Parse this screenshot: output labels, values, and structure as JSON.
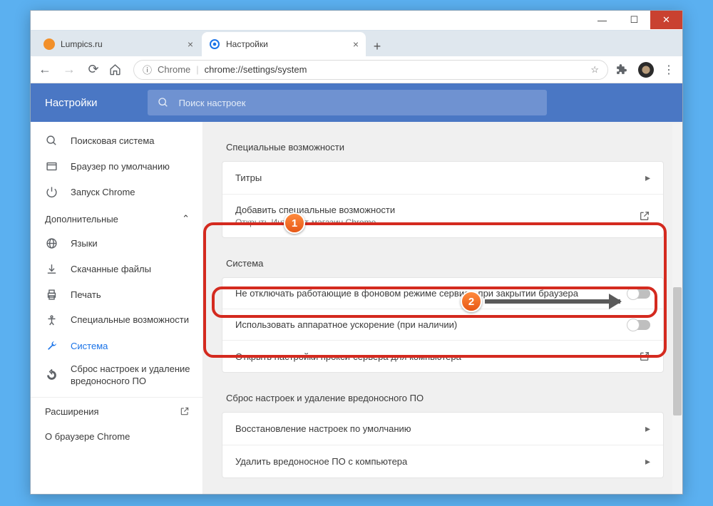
{
  "window": {
    "minimize": "—",
    "maximize": "☐",
    "close": "✕"
  },
  "tabs": {
    "items": [
      {
        "title": "Lumpics.ru",
        "favicon": "#f2902a",
        "active": false
      },
      {
        "title": "Настройки",
        "favicon": "#1a73e8",
        "active": true
      }
    ],
    "newtab": "+"
  },
  "toolbar": {
    "back": "←",
    "forward": "→",
    "reload": "⟳",
    "home": "⌂",
    "secure_icon": "ⓘ",
    "chrome_label": "Chrome",
    "url_path": "chrome://settings/system",
    "star": "☆",
    "ext": "✦",
    "menu": "⋮"
  },
  "header": {
    "title": "Настройки",
    "search_placeholder": "Поиск настроек"
  },
  "sidebar": {
    "items": [
      {
        "icon": "search",
        "label": "Поисковая система"
      },
      {
        "icon": "browser",
        "label": "Браузер по умолчанию"
      },
      {
        "icon": "power",
        "label": "Запуск Chrome"
      }
    ],
    "advanced_label": "Дополнительные",
    "advanced_items": [
      {
        "icon": "globe",
        "label": "Языки"
      },
      {
        "icon": "download",
        "label": "Скачанные файлы"
      },
      {
        "icon": "print",
        "label": "Печать"
      },
      {
        "icon": "accessibility",
        "label": "Специальные возможности"
      },
      {
        "icon": "wrench",
        "label": "Система",
        "active": true
      },
      {
        "icon": "reset",
        "label": "Сброс настроек и удаление вредоносного ПО"
      }
    ],
    "extensions": "Расширения",
    "about": "О браузере Chrome"
  },
  "main": {
    "accessibility": {
      "title": "Специальные возможности",
      "rows": [
        {
          "label": "Титры",
          "type": "chevron"
        },
        {
          "label": "Добавить специальные возможности",
          "sub": "Открыть Интернет-магазин Chrome",
          "type": "external"
        }
      ]
    },
    "system": {
      "title": "Система",
      "rows": [
        {
          "label": "Не отключать работающие в фоновом режиме сервисы при закрытии браузера",
          "type": "toggle"
        },
        {
          "label": "Использовать аппаратное ускорение (при наличии)",
          "type": "toggle"
        },
        {
          "label": "Открыть настройки прокси-сервера для компьютера",
          "type": "external"
        }
      ]
    },
    "reset": {
      "title": "Сброс настроек и удаление вредоносного ПО",
      "rows": [
        {
          "label": "Восстановление настроек по умолчанию",
          "type": "chevron"
        },
        {
          "label": "Удалить вредоносное ПО с компьютера",
          "type": "chevron"
        }
      ]
    }
  },
  "callouts": {
    "one": "1",
    "two": "2"
  }
}
